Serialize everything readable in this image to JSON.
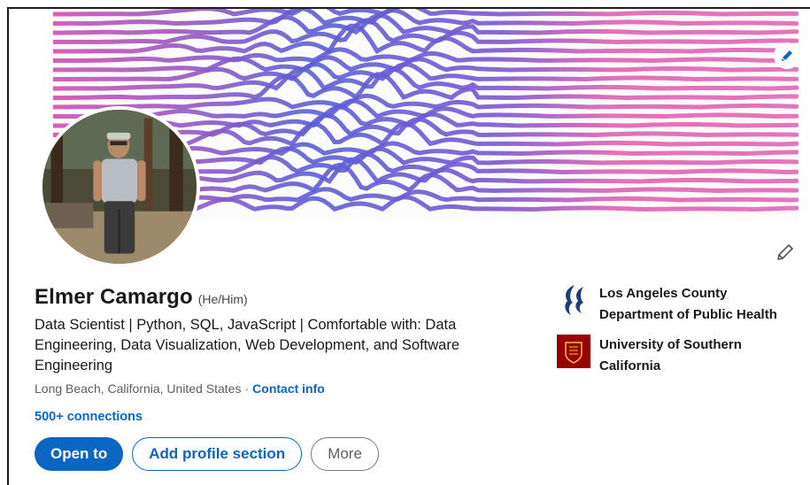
{
  "profile": {
    "name": "Elmer Camargo",
    "pronouns": "(He/Him)",
    "headline": "Data Scientist | Python, SQL, JavaScript | Comfortable with: Data Engineering, Data Visualization, Web Development, and Software Engineering",
    "location": "Long Beach, California, United States",
    "separator": "·",
    "contact_info_label": "Contact info",
    "connections": "500+ connections"
  },
  "actions": {
    "open_to_label": "Open to",
    "add_section_label": "Add profile section",
    "more_label": "More"
  },
  "orgs": [
    {
      "name": "Los Angeles County Department of Public Health",
      "logo": "la-county-public-health-logo"
    },
    {
      "name": "University of Southern California",
      "logo": "usc-seal-logo"
    }
  ],
  "icons": {
    "banner_edit": "pencil-icon",
    "intro_edit": "pencil-icon"
  },
  "colors": {
    "accent": "#0a66c2",
    "banner_blue": "#4f5bd5",
    "banner_pink": "#e255b4",
    "usc_red": "#990000"
  }
}
